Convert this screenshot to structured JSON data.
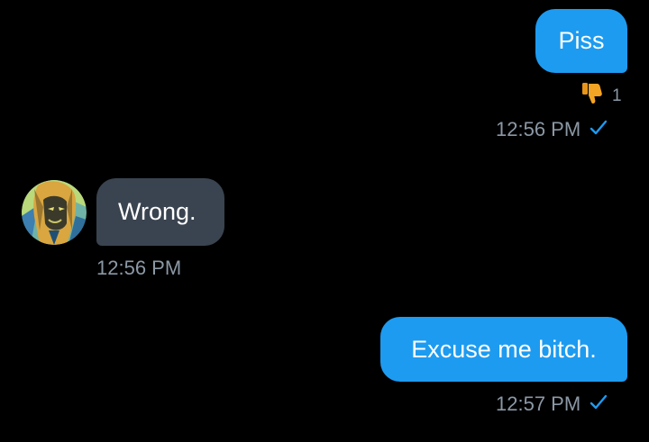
{
  "colors": {
    "background": "#000000",
    "outgoing_bubble": "#1d9bf0",
    "incoming_bubble": "#3a4450",
    "meta_text": "#8b98a5",
    "check_color": "#1d9bf0",
    "reaction_color": "#f4a523"
  },
  "messages": [
    {
      "direction": "outgoing",
      "text": "Piss",
      "time": "12:56 PM",
      "read_icon": "checkmark-icon",
      "reaction": {
        "icon": "thumbs-down-icon",
        "count": "1"
      }
    },
    {
      "direction": "incoming",
      "text": "Wrong.",
      "time": "12:56 PM",
      "avatar_icon": "avatar-anime-character"
    },
    {
      "direction": "outgoing",
      "text": "Excuse me bitch.",
      "time": "12:57 PM",
      "read_icon": "checkmark-icon"
    }
  ]
}
